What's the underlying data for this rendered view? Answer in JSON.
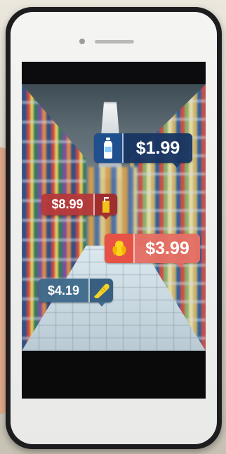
{
  "scene": {
    "phone_color": "#1d1d1f",
    "screen_bezel_color": "#f2f2f0"
  },
  "price_tags": [
    {
      "price": "$1.99",
      "icon": "water-bottle-icon",
      "color": "#163462"
    },
    {
      "price": "$8.99",
      "icon": "juice-box-icon",
      "color": "#b4393a"
    },
    {
      "price": "$3.99",
      "icon": "corn-icon",
      "color": "#e46e64"
    },
    {
      "price": "$4.19",
      "icon": "bread-icon",
      "color": "#3e6a8b"
    }
  ]
}
